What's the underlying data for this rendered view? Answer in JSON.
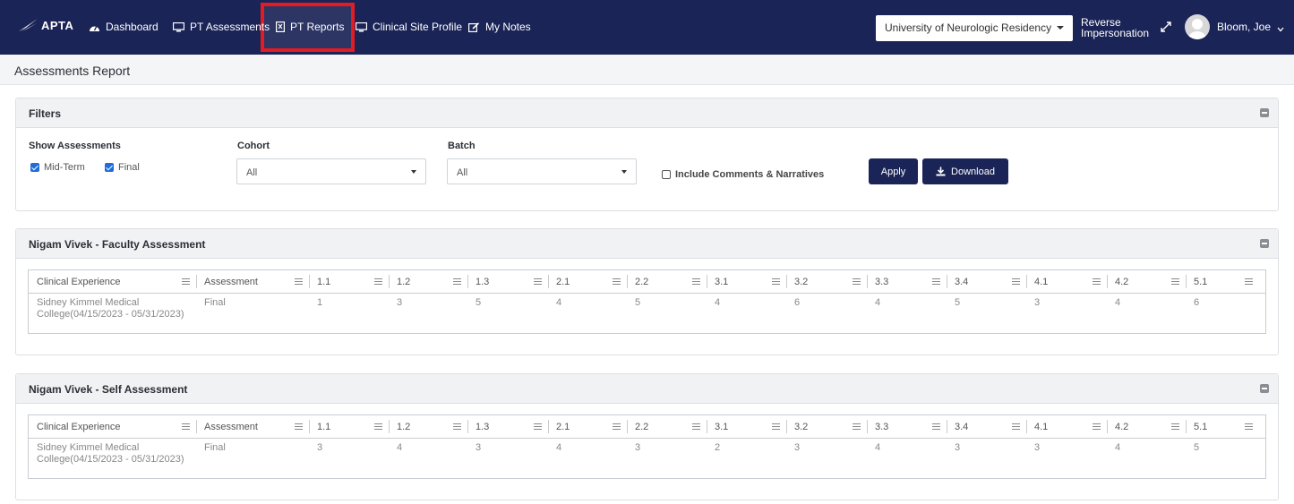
{
  "nav": {
    "logo": "APTA",
    "items": [
      {
        "label": "Dashboard",
        "icon": "dashboard-icon"
      },
      {
        "label": "PT Assessments",
        "icon": "monitor-icon"
      },
      {
        "label": "PT Reports",
        "icon": "report-icon"
      },
      {
        "label": "Clinical Site Profile",
        "icon": "monitor-icon"
      },
      {
        "label": "My Notes",
        "icon": "edit-icon"
      }
    ],
    "university": "University of Neurologic Residency",
    "reverse_impersonation_1": "Reverse",
    "reverse_impersonation_2": "Impersonation",
    "user": "Bloom, Joe"
  },
  "page": {
    "title": "Assessments Report"
  },
  "filters": {
    "title": "Filters",
    "show_label": "Show Assessments",
    "midterm": "Mid-Term",
    "final": "Final",
    "cohort_label": "Cohort",
    "cohort_value": "All",
    "batch_label": "Batch",
    "batch_value": "All",
    "include_comments": "Include Comments & Narratives",
    "apply": "Apply",
    "download": "Download"
  },
  "columns": [
    "Clinical Experience",
    "Assessment",
    "1.1",
    "1.2",
    "1.3",
    "2.1",
    "2.2",
    "3.1",
    "3.2",
    "3.3",
    "3.4",
    "4.1",
    "4.2",
    "5.1"
  ],
  "faculty": {
    "title": "Nigam Vivek - Faculty Assessment",
    "row": {
      "experience_1": "Sidney Kimmel Medical",
      "experience_2": "College(04/15/2023 - 05/31/2023)",
      "assessment": "Final",
      "scores": [
        "1",
        "3",
        "5",
        "4",
        "5",
        "4",
        "6",
        "4",
        "5",
        "3",
        "4",
        "6"
      ]
    }
  },
  "self": {
    "title": "Nigam Vivek - Self Assessment",
    "row": {
      "experience_1": "Sidney Kimmel Medical",
      "experience_2": "College(04/15/2023 - 05/31/2023)",
      "assessment": "Final",
      "scores": [
        "3",
        "4",
        "3",
        "4",
        "3",
        "2",
        "3",
        "4",
        "3",
        "3",
        "4",
        "5"
      ]
    }
  },
  "colors": {
    "navbar": "#1b2457",
    "highlight": "#e31b23",
    "checkbox": "#1e6dd8"
  }
}
